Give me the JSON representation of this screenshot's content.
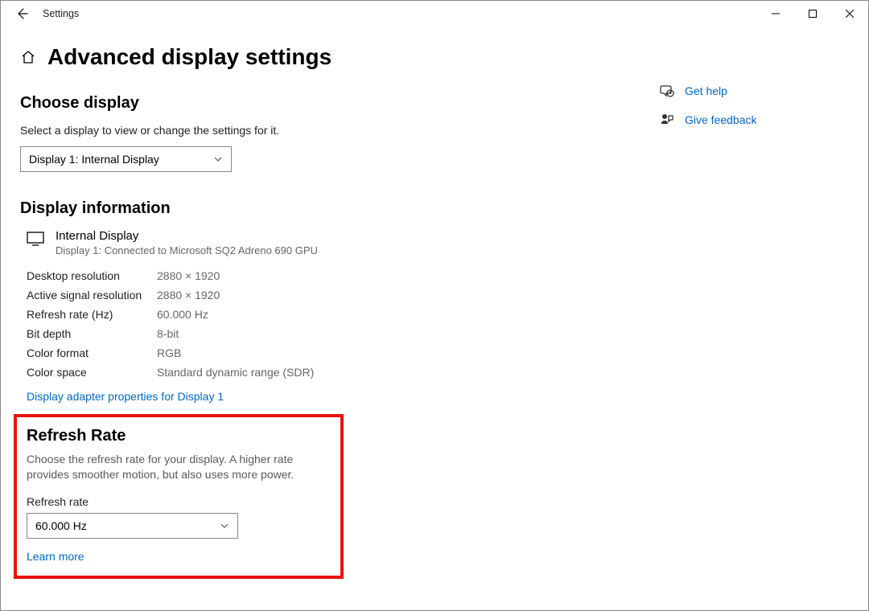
{
  "titlebar": {
    "title": "Settings"
  },
  "page": {
    "title": "Advanced display settings"
  },
  "choose": {
    "heading": "Choose display",
    "desc": "Select a display to view or change the settings for it.",
    "selected": "Display 1: Internal Display"
  },
  "info": {
    "heading": "Display information",
    "name": "Internal Display",
    "sub": "Display 1: Connected to Microsoft SQ2 Adreno 690 GPU",
    "specs": [
      {
        "label": "Desktop resolution",
        "value": "2880 × 1920"
      },
      {
        "label": "Active signal resolution",
        "value": "2880 × 1920"
      },
      {
        "label": "Refresh rate (Hz)",
        "value": "60.000 Hz"
      },
      {
        "label": "Bit depth",
        "value": "8-bit"
      },
      {
        "label": "Color format",
        "value": "RGB"
      },
      {
        "label": "Color space",
        "value": "Standard dynamic range (SDR)"
      }
    ],
    "adapter_link": "Display adapter properties for Display 1"
  },
  "refresh": {
    "heading": "Refresh Rate",
    "desc": "Choose the refresh rate for your display. A higher rate provides smoother motion, but also uses more power.",
    "field_label": "Refresh rate",
    "selected": "60.000 Hz",
    "learn_more": "Learn more"
  },
  "side": {
    "help": "Get help",
    "feedback": "Give feedback"
  }
}
